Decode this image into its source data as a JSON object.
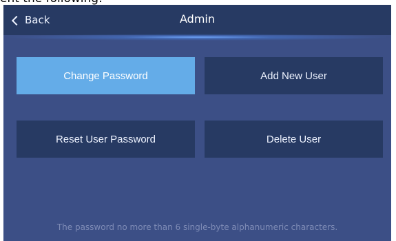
{
  "cropped_text": "ent the following:",
  "header": {
    "back_label": "Back",
    "title": "Admin"
  },
  "buttons": {
    "change_password": "Change Password",
    "add_new_user": "Add New User",
    "reset_user_password": "Reset User Password",
    "delete_user": "Delete User"
  },
  "hint": "The password no more than 6 single-byte alphanumeric characters.",
  "colors": {
    "background": "#3c4f86",
    "header": "#273a63",
    "button": "#273a63",
    "active_button": "#64ace8",
    "text": "#eef3ff",
    "hint": "#7f8cb6"
  },
  "icons": {
    "back": "chevron-left-icon"
  }
}
